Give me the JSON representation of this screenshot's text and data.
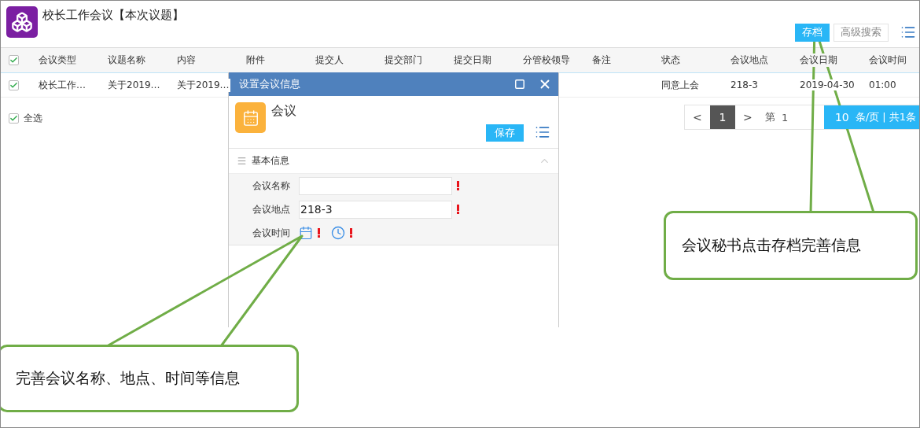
{
  "app": {
    "title": "校长工作会议【本次议题】"
  },
  "toolbar": [
    {
      "label": "存档",
      "kind": "primary"
    },
    {
      "label": "高级搜索",
      "kind": "plain"
    }
  ],
  "table": {
    "header_checked": true,
    "columns": [
      "会议类型",
      "议题名称",
      "内容",
      "附件",
      "提交人",
      "提交部门",
      "提交日期",
      "分管校领导",
      "备注",
      "状态",
      "会议地点",
      "会议日期",
      "会议时间"
    ],
    "rows": [
      {
        "checked": true,
        "cells": [
          "校长工作…",
          "关于2019…",
          "关于2019…",
          null,
          null,
          null,
          null,
          null,
          null,
          "同意上会",
          "218-3",
          "2019-04-30",
          "01:00"
        ]
      }
    ]
  },
  "select_all": {
    "label": "全选",
    "checked": true
  },
  "pagination": {
    "prev": "<",
    "pages": [
      {
        "label": "1",
        "selected": true
      }
    ],
    "next": ">",
    "page_label": "第",
    "page_input": "1",
    "page_size": "10",
    "summary": "条/页 | 共1条"
  },
  "dialog": {
    "title": "设置会议信息",
    "heading": "会议",
    "save": "保存",
    "section": {
      "title": "基本信息",
      "expanded": true
    },
    "fields": [
      {
        "kind": "text",
        "label": "会议名称",
        "required": true
      },
      {
        "kind": "text",
        "label": "会议地点",
        "value": "218-3",
        "required": true
      },
      {
        "kind": "datetime",
        "label": "会议时间",
        "required": true
      }
    ]
  },
  "callouts": [
    {
      "text": "会议秘书点击存档完善信息"
    },
    {
      "text": "完善会议名称、地点、时间等信息"
    }
  ]
}
